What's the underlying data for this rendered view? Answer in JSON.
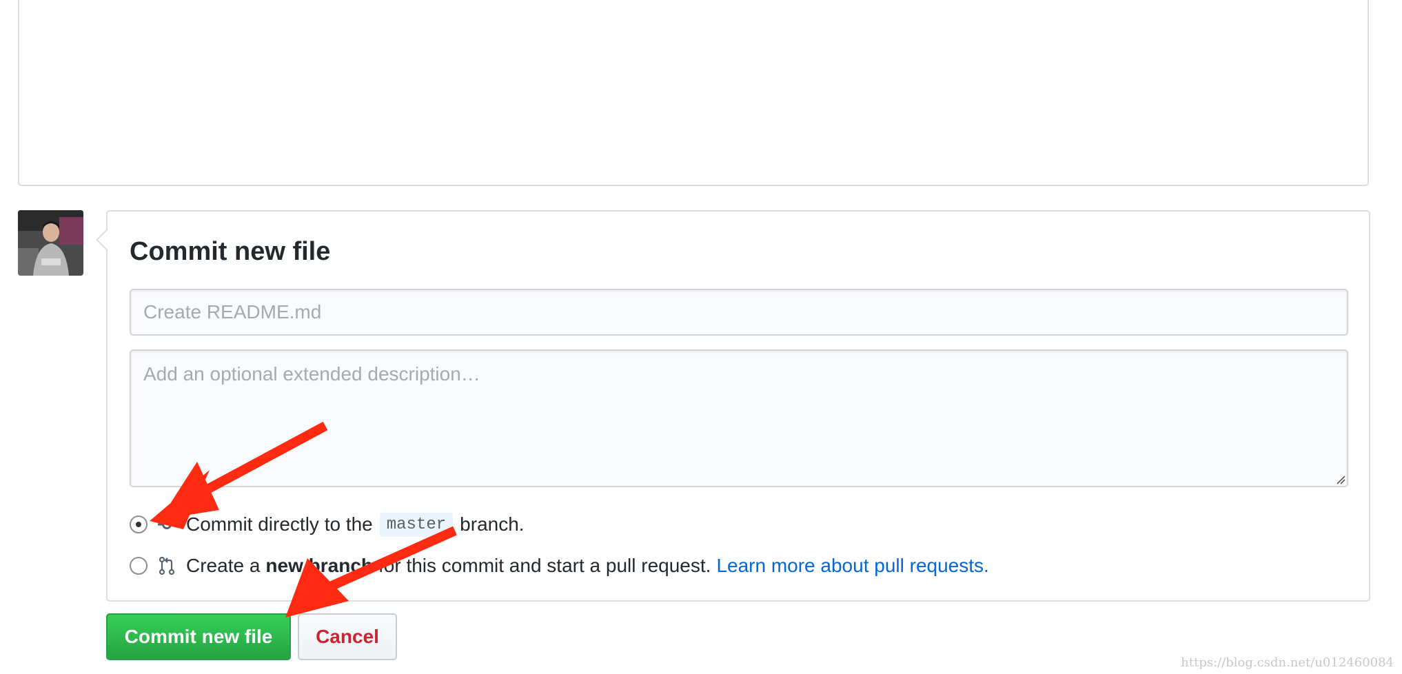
{
  "commit": {
    "title": "Commit new file",
    "summary_placeholder": "Create README.md",
    "summary_value": "",
    "description_placeholder": "Add an optional extended description…",
    "description_value": ""
  },
  "options": {
    "direct": {
      "prefix": "Commit directly to the",
      "branch": "master",
      "suffix": "branch.",
      "selected": true,
      "icon": "git-commit-icon"
    },
    "new_branch": {
      "prefix": "Create a",
      "bold": "new branch",
      "suffix": "for this commit and start a pull request.",
      "link": "Learn more about pull requests.",
      "selected": false,
      "icon": "git-pull-request-icon"
    }
  },
  "buttons": {
    "commit_label": "Commit new file",
    "cancel_label": "Cancel"
  },
  "watermark": "https://blog.csdn.net/u012460084",
  "colors": {
    "primary_green": "#28a745",
    "cancel_red": "#cb2431",
    "link_blue": "#0366d6",
    "annotation_arrow": "#ff2a12"
  }
}
